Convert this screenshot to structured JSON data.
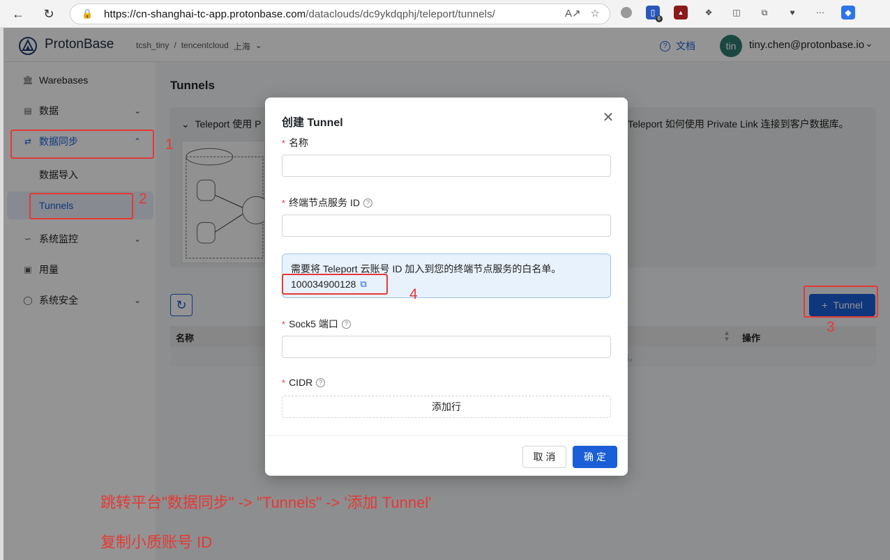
{
  "browser": {
    "url_host": "https://cn-shanghai-tc-app.protonbase.com",
    "url_path": "/dataclouds/dc9ykdqphj/teleport/tunnels/",
    "ext_badge_1": "6"
  },
  "header": {
    "brand": "ProtonBase",
    "crumb_1": "tcsh_tiny",
    "crumb_sep": "/",
    "crumb_2": "tencentcloud",
    "crumb_3": "上海",
    "docs": "文档",
    "avatar_initials": "tin",
    "user_email": "tiny.chen@protonbase.io"
  },
  "sidebar": {
    "items": [
      {
        "label": "Warebases"
      },
      {
        "label": "数据"
      },
      {
        "label": "数据同步"
      },
      {
        "label": "数据导入"
      },
      {
        "label": "Tunnels"
      },
      {
        "label": "系统监控"
      },
      {
        "label": "用量"
      },
      {
        "label": "系统安全"
      }
    ]
  },
  "main": {
    "title": "Tunnels",
    "info_line": "Teleport 使用 P",
    "info_right": "Teleport 如何使用 Private Link 连接到客户数据库。",
    "add_tunnel": "Tunnel",
    "table": {
      "col_name": "名称",
      "col_ops": "操作",
      "empty_tail": "络。"
    }
  },
  "modal": {
    "title": "创建 Tunnel",
    "field_name_label": "名称",
    "field_endpoint_label": "终端节点服务 ID",
    "notice_text": "需要将 Teleport 云账号 ID 加入到您的终端节点服务的白名单。",
    "account_id": "100034900128",
    "field_sock5_label": "Sock5 端口",
    "field_cidr_label": "CIDR",
    "add_row": "添加行",
    "cancel": "取 消",
    "ok": "确 定"
  },
  "annotations": {
    "num_1": "1",
    "num_2": "2",
    "num_3": "3",
    "num_4": "4",
    "note_1": "跳转平台\"数据同步\" -> \"Tunnels\" -> '添加 Tunnel'",
    "note_2": "复制小质账号 ID",
    "color": "#e53935"
  },
  "colors": {
    "accent": "#1a5fd8",
    "avatar_bg": "#2d7d6e"
  }
}
